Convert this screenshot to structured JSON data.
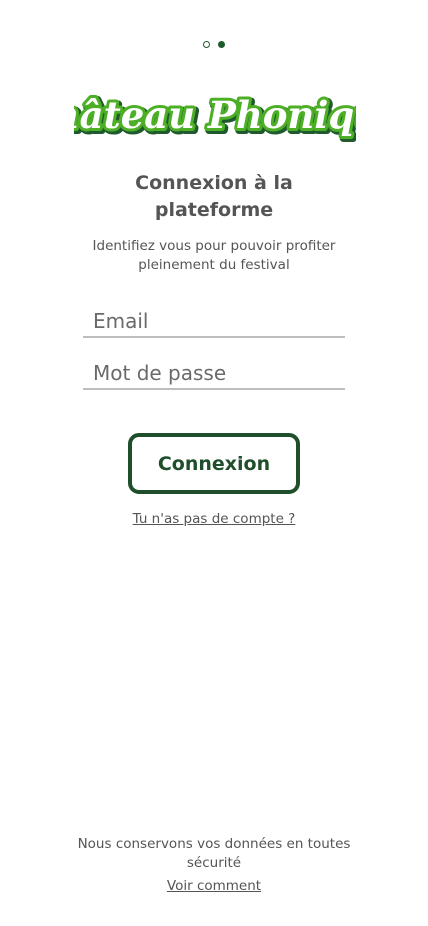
{
  "pager": {
    "pages": [
      "inactive",
      "active"
    ]
  },
  "logo": {
    "text": "Château Phonique",
    "colors": {
      "fill": "#ffffff",
      "outline": "#4caf26",
      "shadow": "#1f5a2e"
    }
  },
  "login": {
    "title_line1": "Connexion à la",
    "title_line2": "plateforme",
    "subtitle_line1": "Identifiez vous pour pouvoir profiter",
    "subtitle_line2": "pleinement du festival",
    "email_placeholder": "Email",
    "password_placeholder": "Mot de passe",
    "submit_label": "Connexion",
    "no_account_link": "Tu n'as pas de compte ?"
  },
  "footer": {
    "security_line1": "Nous conservons vos données en toutes",
    "security_line2": "sécurité",
    "see_how_link": "Voir comment"
  },
  "colors": {
    "accent": "#1f4f2a",
    "text": "#555555",
    "underline": "#bdbdbd"
  }
}
